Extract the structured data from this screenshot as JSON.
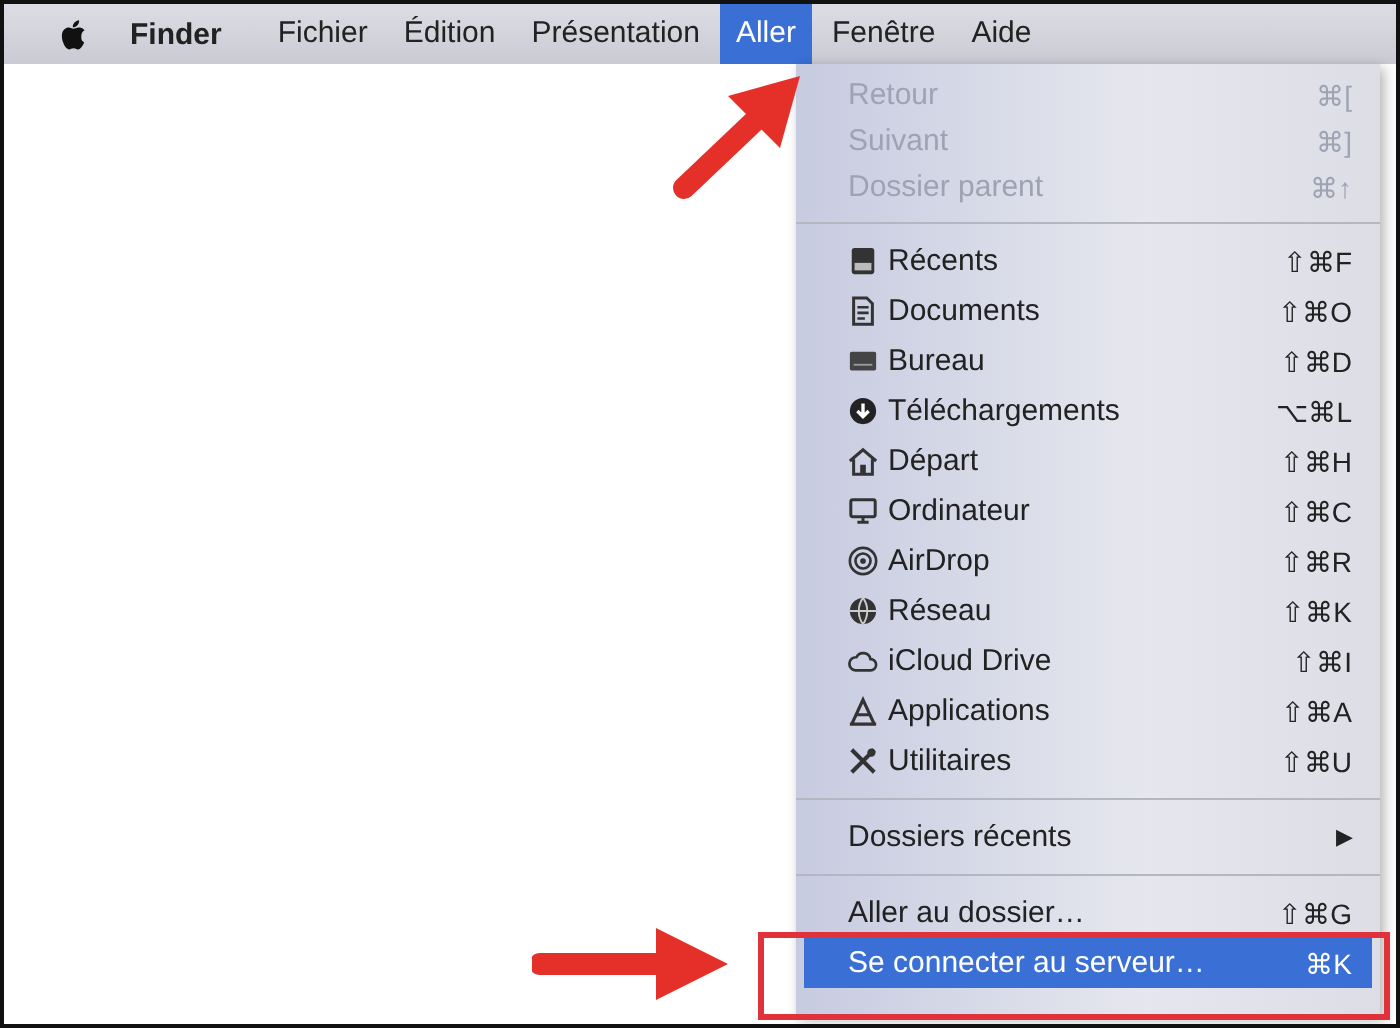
{
  "menubar": {
    "app": "Finder",
    "menus": [
      {
        "label": "Fichier",
        "selected": false
      },
      {
        "label": "Édition",
        "selected": false
      },
      {
        "label": "Présentation",
        "selected": false
      },
      {
        "label": "Aller",
        "selected": true
      },
      {
        "label": "Fenêtre",
        "selected": false
      },
      {
        "label": "Aide",
        "selected": false
      }
    ]
  },
  "menu": {
    "sections": [
      {
        "items": [
          {
            "label": "Retour",
            "shortcut": "⌘[",
            "disabled": true,
            "selected": false
          },
          {
            "label": "Suivant",
            "shortcut": "⌘]",
            "disabled": true,
            "selected": false
          },
          {
            "label": "Dossier parent",
            "shortcut": "⌘↑",
            "disabled": true,
            "selected": false
          }
        ]
      },
      {
        "items": [
          {
            "label": "Récents",
            "shortcut": "⇧⌘F",
            "disabled": false,
            "selected": false
          },
          {
            "label": "Documents",
            "shortcut": "⇧⌘O",
            "disabled": false,
            "selected": false
          },
          {
            "label": "Bureau",
            "shortcut": "⇧⌘D",
            "disabled": false,
            "selected": false
          },
          {
            "label": "Téléchargements",
            "shortcut": "⌥⌘L",
            "disabled": false,
            "selected": false
          },
          {
            "label": "Départ",
            "shortcut": "⇧⌘H",
            "disabled": false,
            "selected": false
          },
          {
            "label": "Ordinateur",
            "shortcut": "⇧⌘C",
            "disabled": false,
            "selected": false
          },
          {
            "label": "AirDrop",
            "shortcut": "⇧⌘R",
            "disabled": false,
            "selected": false
          },
          {
            "label": "Réseau",
            "shortcut": "⇧⌘K",
            "disabled": false,
            "selected": false
          },
          {
            "label": "iCloud Drive",
            "shortcut": "⇧⌘I",
            "disabled": false,
            "selected": false
          },
          {
            "label": "Applications",
            "shortcut": "⇧⌘A",
            "disabled": false,
            "selected": false
          },
          {
            "label": "Utilitaires",
            "shortcut": "⇧⌘U",
            "disabled": false,
            "selected": false
          }
        ]
      },
      {
        "items": [
          {
            "label": "Dossiers récents",
            "submenu": "▶",
            "disabled": false,
            "selected": false
          }
        ]
      },
      {
        "items": [
          {
            "label": "Aller au dossier…",
            "shortcut": "⇧⌘G",
            "disabled": false,
            "selected": false
          },
          {
            "label": "Se connecter au serveur…",
            "shortcut": "⌘K",
            "disabled": false,
            "selected": true
          }
        ]
      }
    ]
  }
}
